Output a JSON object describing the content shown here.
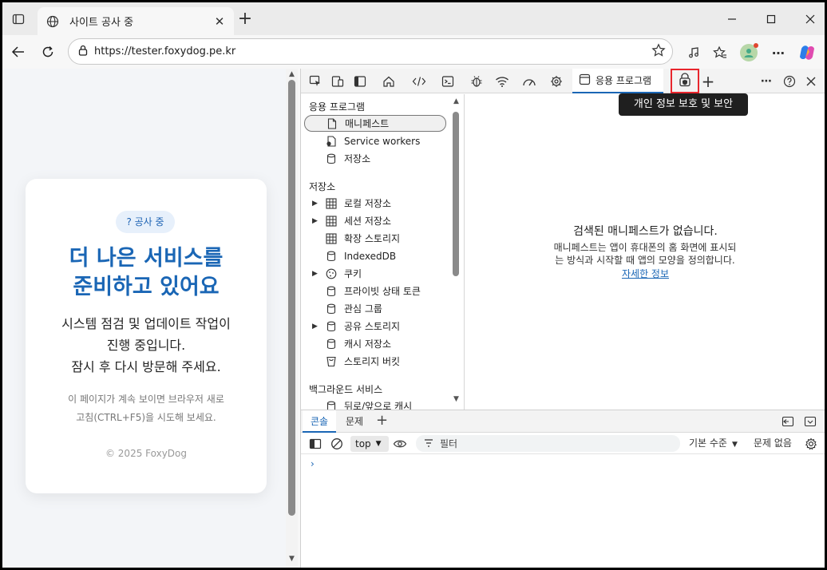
{
  "browser": {
    "tab_title": "사이트 공사 중",
    "tab_close": "✕",
    "new_tab": "+",
    "url": "https://tester.foxydog.pe.kr",
    "more_label": "⋯"
  },
  "page": {
    "badge": "? 공사 중",
    "headline_line1": "더 나은 서비스를",
    "headline_line2": "준비하고 있어요",
    "desc_line1": "시스템 점검 및 업데이트 작업이",
    "desc_line2": "진행 중입니다.",
    "desc_line3": "잠시 후 다시 방문해 주세요.",
    "hint_line1": "이 페이지가 계속 보이면 브라우저 새로",
    "hint_line2": "고침(CTRL+F5)을 시도해 보세요.",
    "copyright": "© 2025 FoxyDog"
  },
  "devtools": {
    "app_tab_label": "응용 프로그램",
    "add_tab": "+",
    "tooltip": "개인 정보 보호 및 보안",
    "sidebar": {
      "section_app": "응용 프로그램",
      "app_items": [
        {
          "label": "매니페스트",
          "icon": "file-icon"
        },
        {
          "label": "Service workers",
          "icon": "gear-file-icon"
        },
        {
          "label": "저장소",
          "icon": "database-icon"
        }
      ],
      "section_storage": "저장소",
      "storage_items": [
        {
          "label": "로컬 저장소",
          "icon": "grid-icon",
          "expandable": true
        },
        {
          "label": "세션 저장소",
          "icon": "grid-icon",
          "expandable": true
        },
        {
          "label": "확장 스토리지",
          "icon": "grid-icon",
          "expandable": false
        },
        {
          "label": "IndexedDB",
          "icon": "database-icon",
          "expandable": false
        },
        {
          "label": "쿠키",
          "icon": "cookie-icon",
          "expandable": true
        },
        {
          "label": "프라이빗 상태 토큰",
          "icon": "database-icon",
          "expandable": false
        },
        {
          "label": "관심 그룹",
          "icon": "database-icon",
          "expandable": false
        },
        {
          "label": "공유 스토리지",
          "icon": "database-icon",
          "expandable": true
        },
        {
          "label": "캐시 저장소",
          "icon": "database-icon",
          "expandable": false
        },
        {
          "label": "스토리지 버킷",
          "icon": "bucket-icon",
          "expandable": false
        }
      ],
      "section_background": "백그라운드 서비스",
      "background_items": [
        {
          "label": "뒤로/앞으로 캐시",
          "icon": "database-icon"
        }
      ]
    },
    "main": {
      "empty_title": "검색된 매니페스트가 없습니다.",
      "empty_desc_line1": "매니페스트는 앱이 휴대폰의 홈 화면에 표시되",
      "empty_desc_line2": "는 방식과 시작할 때 앱의 모양을 정의합니다.",
      "learn_more": "자세한 정보"
    },
    "drawer": {
      "tab_console": "콘솔",
      "tab_issues": "문제",
      "add": "+",
      "context": "top",
      "filter_placeholder": "필터",
      "levels": "기본 수준",
      "issues": "문제 없음",
      "prompt": "›"
    }
  },
  "colors": {
    "accent": "#1a66b5",
    "highlight_border": "#e8262d"
  }
}
